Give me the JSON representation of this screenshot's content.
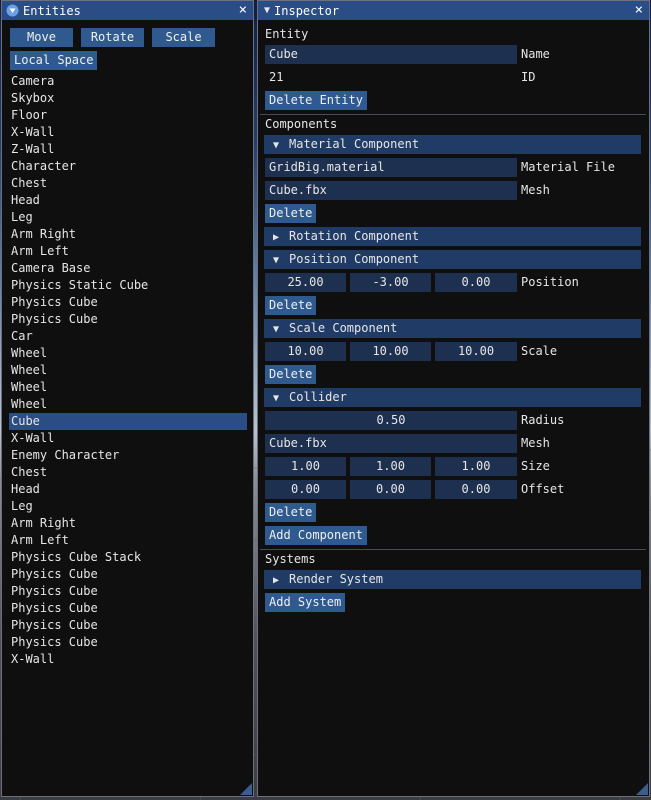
{
  "entities": {
    "title": "Entities",
    "buttons": {
      "move": "Move",
      "rotate": "Rotate",
      "scale": "Scale",
      "local_space": "Local Space"
    },
    "items": [
      "Camera",
      "Skybox",
      "Floor",
      "X-Wall",
      "Z-Wall",
      "Character",
      "Chest",
      "Head",
      "Leg",
      "Arm Right",
      "Arm Left",
      "Camera Base",
      "Physics Static Cube",
      "Physics Cube",
      "Physics Cube",
      "Car",
      "Wheel",
      "Wheel",
      "Wheel",
      "Wheel",
      "Cube",
      "X-Wall",
      "Enemy Character",
      "Chest",
      "Head",
      "Leg",
      "Arm Right",
      "Arm Left",
      "Physics Cube Stack",
      "Physics Cube",
      "Physics Cube",
      "Physics Cube",
      "Physics Cube",
      "Physics Cube",
      "X-Wall"
    ],
    "selected_index": 20
  },
  "inspector": {
    "title": "Inspector",
    "entity": {
      "section": "Entity",
      "name_value": "Cube",
      "name_label": "Name",
      "id_value": "21",
      "id_label": "ID",
      "delete_label": "Delete Entity"
    },
    "components_label": "Components",
    "material": {
      "header": "Material Component",
      "file_value": "GridBig.material",
      "file_label": "Material File",
      "mesh_value": "Cube.fbx",
      "mesh_label": "Mesh",
      "delete_label": "Delete"
    },
    "rotation": {
      "header": "Rotation Component"
    },
    "position": {
      "header": "Position Component",
      "x": "25.00",
      "y": "-3.00",
      "z": "0.00",
      "label": "Position",
      "delete_label": "Delete"
    },
    "scale": {
      "header": "Scale Component",
      "x": "10.00",
      "y": "10.00",
      "z": "10.00",
      "label": "Scale",
      "delete_label": "Delete"
    },
    "collider": {
      "header": "Collider",
      "radius_value": "0.50",
      "radius_label": "Radius",
      "mesh_value": "Cube.fbx",
      "mesh_label": "Mesh",
      "size": {
        "x": "1.00",
        "y": "1.00",
        "z": "1.00",
        "label": "Size"
      },
      "offset": {
        "x": "0.00",
        "y": "0.00",
        "z": "0.00",
        "label": "Offset"
      },
      "delete_label": "Delete"
    },
    "add_component_label": "Add Component",
    "systems_label": "Systems",
    "render_system": {
      "header": "Render System"
    },
    "add_system_label": "Add System"
  },
  "colors": {
    "title_bar": "#2a4d86",
    "button": "#2f5a8f",
    "field": "#1d3050",
    "header": "#203c66",
    "panel": "#0f0f0f"
  }
}
